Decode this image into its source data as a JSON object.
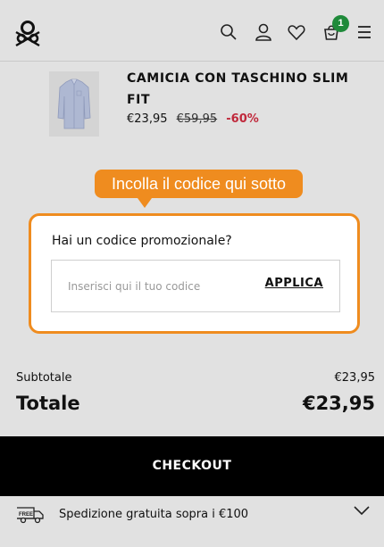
{
  "header": {
    "cart_count": "1",
    "icons": [
      "logo-icon",
      "search-icon",
      "account-icon",
      "heart-icon",
      "cart-icon",
      "menu-icon"
    ]
  },
  "product": {
    "title": "CAMICIA CON TASCHINO SLIM FIT",
    "price": "€23,95",
    "old_price": "€59,95",
    "discount": "-60%"
  },
  "callout": {
    "text": "Incolla il codice qui sotto"
  },
  "promo": {
    "label": "Hai un codice promozionale?",
    "placeholder": "Inserisci qui il tuo codice",
    "value": "",
    "apply_label": "APPLICA"
  },
  "summary": {
    "subtotal_label": "Subtotale",
    "subtotal_value": "€23,95",
    "total_label": "Totale",
    "total_value": "€23,95"
  },
  "checkout": {
    "label": "CHECKOUT"
  },
  "shipping": {
    "icon_text": "FREE",
    "text": "Spedizione gratuita sopra i €100"
  },
  "colors": {
    "accent": "#ef8c1f",
    "badge": "#1f8a3a",
    "discount": "#c0283b",
    "background": "#e1e1e1"
  }
}
